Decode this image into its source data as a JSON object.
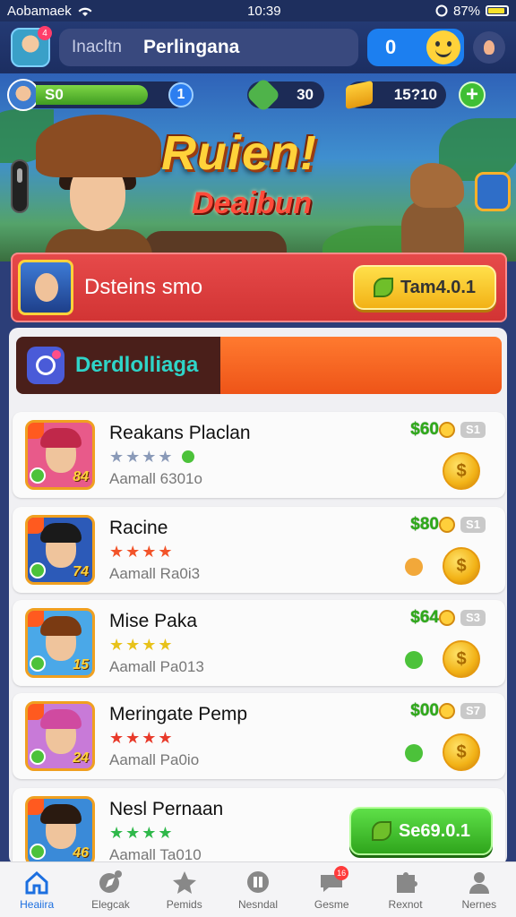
{
  "status_bar": {
    "carrier": "Aobamaek",
    "time": "10:39",
    "battery": "87%"
  },
  "header": {
    "avatar_badge": "4",
    "search_placeholder": "Inacltn",
    "title": "Perlingana",
    "coins": "0"
  },
  "hud": {
    "xp_label": "S0",
    "xp_progress": 0.78,
    "level": "1",
    "gems": "30",
    "gold": "15?10",
    "plus": "+"
  },
  "hero": {
    "title": "Ruien!",
    "subtitle": "Deaibun"
  },
  "featured": {
    "text": "Dsteins smo",
    "button_label": "Tam4.0.1"
  },
  "section": {
    "title": "Derdlolliaga"
  },
  "rows": [
    {
      "name": "Reakans Placlan",
      "stars": "★★★★",
      "subtitle": "Aamall 6301o",
      "price": "$60",
      "badge": "S1",
      "coin": "$",
      "star_color": "#8a9ab8",
      "num": "84",
      "hair": "#c0284a",
      "bg": "#e85a8a"
    },
    {
      "name": "Racine",
      "stars": "★★★★",
      "subtitle": "Aamall Ra0i3",
      "price": "$80",
      "badge": "S1",
      "coin": "$",
      "star_color": "#f2542a",
      "num": "74",
      "hair": "#1a1a1a",
      "bg": "#2c5ab8"
    },
    {
      "name": "Mise Paka",
      "stars": "★★★★",
      "subtitle": "Aamall Pa013",
      "price": "$64",
      "badge": "S3",
      "coin": "$",
      "star_color": "#e8c21a",
      "num": "15",
      "hair": "#7a3a12",
      "bg": "#4aa8e8"
    },
    {
      "name": "Meringate Pemp",
      "stars": "★★★★",
      "subtitle": "Aamall Pa0io",
      "price": "$00",
      "badge": "S7",
      "coin": "$",
      "star_color": "#e83a2a",
      "num": "24",
      "hair": "#d04aa0",
      "bg": "#c87ad8"
    },
    {
      "name": "Nesl Pernaan",
      "stars": "★★★★",
      "subtitle": "Aamall Ta010",
      "price": "",
      "badge": "",
      "coin": "",
      "star_color": "#2fb84a",
      "num": "46",
      "hair": "#2a1a10",
      "bg": "#3a8ad8",
      "button_label": "Se69.0.1"
    }
  ],
  "nav": [
    {
      "label": "Heaiira",
      "icon": "home-icon"
    },
    {
      "label": "Elegcak",
      "icon": "compass-icon"
    },
    {
      "label": "Pemids",
      "icon": "star-icon"
    },
    {
      "label": "Nesndal",
      "icon": "calendar-icon"
    },
    {
      "label": "Gesme",
      "icon": "chat-icon",
      "badge": "16"
    },
    {
      "label": "Rexnot",
      "icon": "puzzle-icon"
    },
    {
      "label": "Nernes",
      "icon": "person-icon"
    }
  ],
  "colors": {
    "accent": "#1c6fe0",
    "featured_red": "#dd3d3d",
    "section_orange": "#f2621f",
    "green_button": "#3fbf34"
  }
}
